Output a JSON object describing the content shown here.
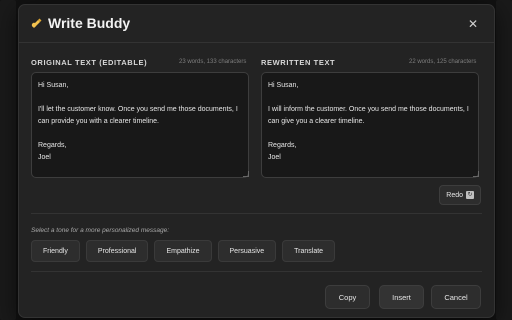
{
  "dialog": {
    "title": "Write Buddy",
    "title_icon": "writing-hand-icon",
    "close_icon": "close-icon"
  },
  "original": {
    "label": "ORIGINAL TEXT (EDITABLE)",
    "count": "23 words, 133 characters",
    "text": "Hi Susan,\n\nI'll let the customer know. Once you send me those documents, I can provide you with a clearer timeline.\n\nRegards,\nJoel"
  },
  "rewritten": {
    "label": "REWRITTEN TEXT",
    "count": "22 words, 125 characters",
    "text": "Hi Susan,\n\nI will inform the customer. Once you send me those documents, I can give you a clearer timeline.\n\nRegards,\nJoel"
  },
  "redo": {
    "label": "Redo",
    "icon": "redo-icon"
  },
  "tone": {
    "hint": "Select a tone for a more personalized message:",
    "options": [
      "Friendly",
      "Professional",
      "Empathize",
      "Persuasive",
      "Translate"
    ]
  },
  "footer": {
    "copy": "Copy",
    "insert": "Insert",
    "cancel": "Cancel"
  },
  "colors": {
    "modal_bg": "#232323",
    "textbox_bg": "#181818",
    "button_bg": "#2d2d2d"
  }
}
